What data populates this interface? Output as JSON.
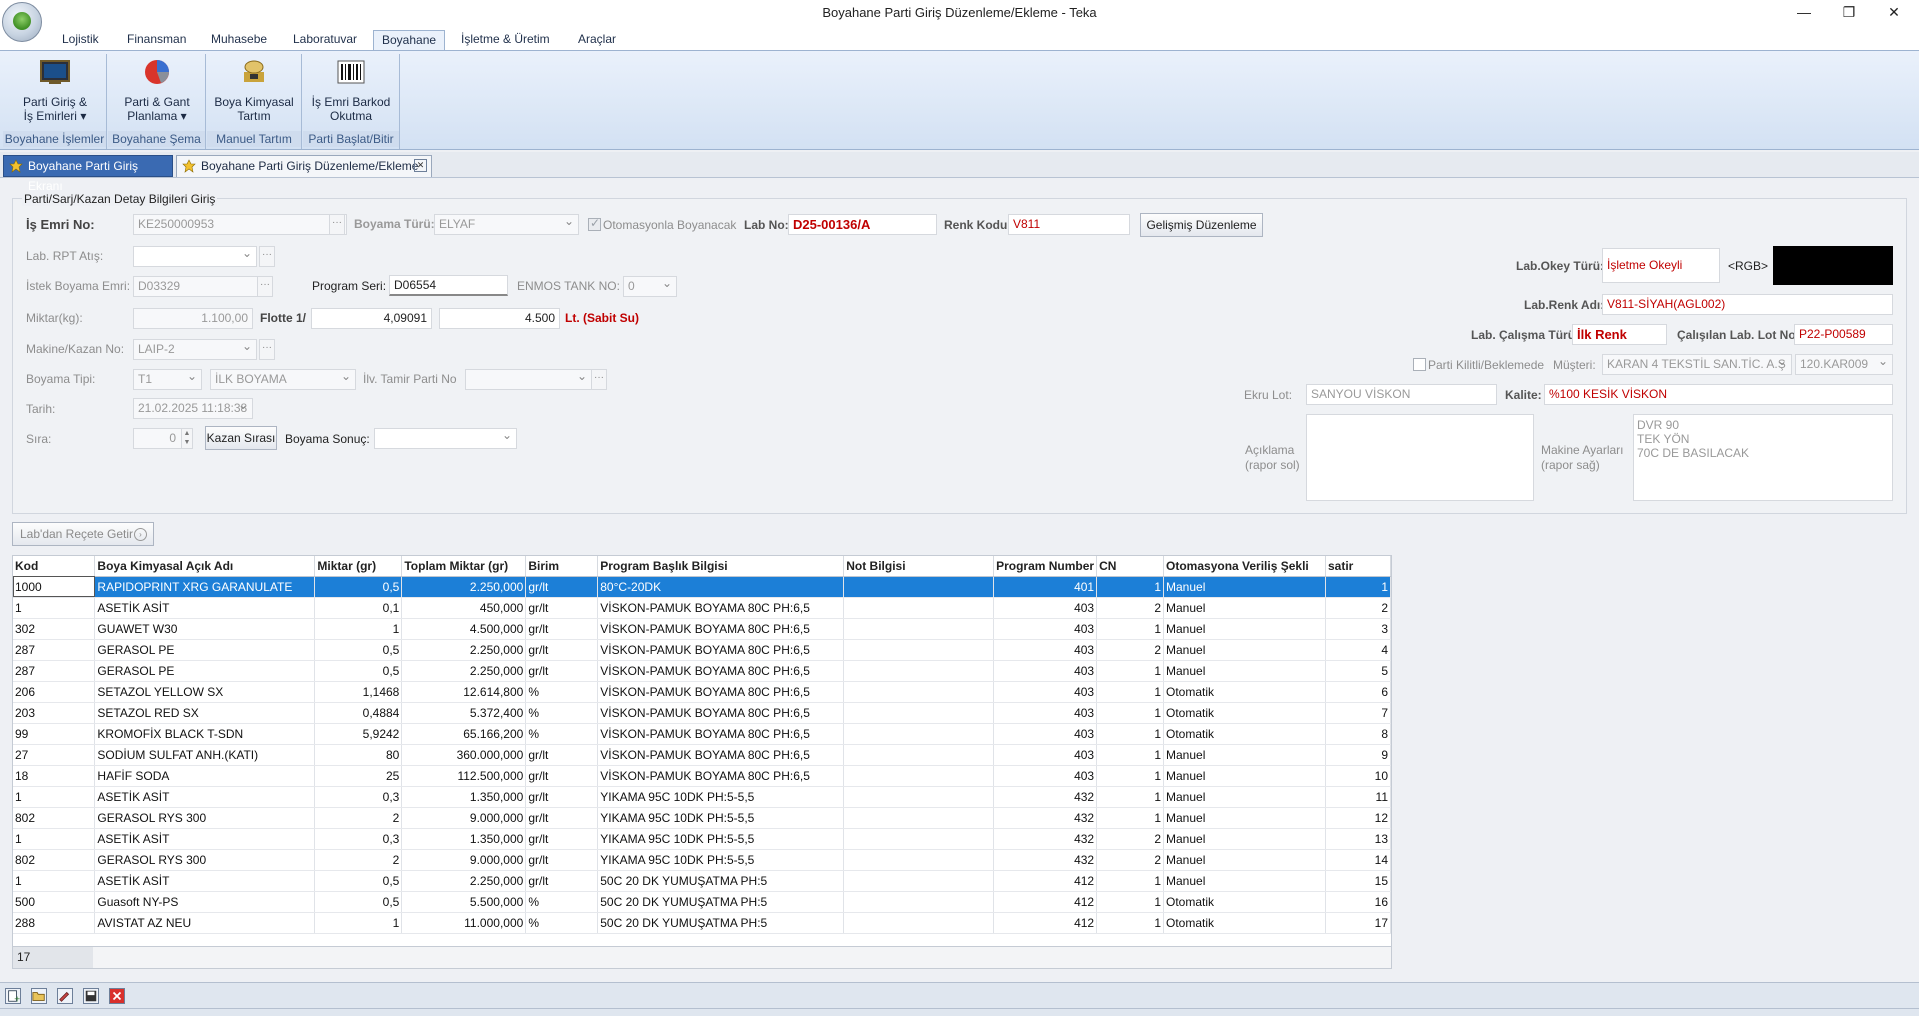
{
  "window": {
    "title": "Boyahane Parti Giriş Düzenleme/Ekleme - Teka",
    "minimize": "—",
    "maximize": "❐",
    "close": "✕"
  },
  "ribbon_tabs": [
    "Lojistik",
    "Finansman",
    "Muhasebe",
    "Laboratuvar",
    "Boyahane",
    "İşletme & Üretim",
    "Araçlar"
  ],
  "ribbon": {
    "btn1_l1": "Parti Giriş &",
    "btn1_l2": "İş Emirleri",
    "grp1": "Boyahane İşlemler",
    "btn2_l1": "Parti & Gant",
    "btn2_l2": "Planlama",
    "grp2": "Boyahane Şema",
    "btn3_l1": "Boya Kimyasal",
    "btn3_l2": "Tartım",
    "grp3": "Manuel Tartım",
    "btn4_l1": "İş Emri Barkod",
    "btn4_l2": "Okutma",
    "grp4": "Parti Başlat/Bitir"
  },
  "doc_tabs": {
    "tab1": "Boyahane Parti Giriş Ekranı",
    "tab2": "Boyahane Parti Giriş Düzenleme/Ekleme",
    "close": "✕"
  },
  "form": {
    "group_title": "Parti/Sarj/Kazan Detay Bilgileri Giriş",
    "is_emri_label": "İş Emri No:",
    "is_emri": "KE250000953",
    "boyama_turu_label": "Boyama Türü:",
    "boyama_turu": "ELYAF",
    "otomasyon_label": "Otomasyonla Boyanacak",
    "lab_no_label": "Lab No:",
    "lab_no": "D25-00136/A",
    "renk_kodu_label": "Renk Kodu:",
    "renk_kodu": "V811",
    "gelismis_btn": "Gelişmiş Düzenleme",
    "lab_rpt_label": "Lab. RPT Atış:",
    "istek_label": "İstek Boyama Emri:",
    "istek": "D03329",
    "program_seri_label": "Program Seri:",
    "program_seri": "D06554",
    "enmos_label": "ENMOS TANK NO:",
    "enmos": "0",
    "miktar_label": "Miktar(kg):",
    "miktar": "1.100,00",
    "flotte_label": "Flotte 1/",
    "flotte": "4,09091",
    "flotte_lt": "4.500",
    "sabit_su": "Lt. (Sabit Su)",
    "makine_label": "Makine/Kazan No:",
    "makine": "LAIP-2",
    "boyama_tipi_label": "Boyama Tipi:",
    "boyama_tipi": "T1",
    "boyama_tipi_desc": "İLK BOYAMA",
    "ilv_label": "İlv. Tamir Parti No",
    "tarih_label": "Tarih:",
    "tarih": "21.02.2025 11:18:38",
    "sira_label": "Sıra:",
    "sira": "0",
    "kazan_btn": "Kazan Sırası",
    "boyama_sonuc_label": "Boyama Sonuç:",
    "lab_okey_label": "Lab.Okey Türü:",
    "lab_okey": "İşletme Okeyli",
    "rgb_label": "<RGB>",
    "rgb_color": "#000000",
    "lab_renk_label": "Lab.Renk Adı:",
    "lab_renk": "V811-SİYAH(AGL002)",
    "lab_calisma_label": "Lab. Çalışma Türü:",
    "lab_calisma": "İlk Renk",
    "calisilan_label": "Çalışılan Lab. Lot No:",
    "calisilan": "P22-P00589",
    "parti_kilit_label": "Parti Kilitli/Beklemede",
    "musteri_label": "Müşteri:",
    "musteri": "KARAN 4 TEKSTİL SAN.TİC. A.Ş",
    "musteri_kod": "120.KAR009",
    "ekru_label": "Ekru Lot:",
    "ekru": "SANYOU VİSKON",
    "kalite_label": "Kalite:",
    "kalite": "%100 KESİK VİSKON",
    "aciklama_l1": "Açıklama",
    "aciklama_l2": "(rapor sol)",
    "makine_ayar_l1": "Makine Ayarları",
    "makine_ayar_l2": "(rapor sağ)",
    "makine_ayar": "DVR 90\nTEK YÖN\n70C DE BASILACAK",
    "lab_recete_btn": "Lab'dan Reçete Getir"
  },
  "grid": {
    "headers": [
      "Kod",
      "Boya Kimyasal Açık Adı",
      "Miktar (gr)",
      "Toplam Miktar (gr)",
      "Birim",
      "Program Başlık Bilgisi",
      "Not Bilgisi",
      "Program Number",
      "CN",
      "Otomasyona Veriliş Şekli",
      "satir"
    ],
    "rows": [
      [
        "1000",
        "RAPIDOPRINT XRG GARANULATE",
        "0,5",
        "2.250,000",
        "gr/lt",
        "80°C-20DK",
        "",
        "401",
        "1",
        "Manuel",
        "1"
      ],
      [
        "1",
        "ASETİK ASİT",
        "0,1",
        "450,000",
        "gr/lt",
        "VİSKON-PAMUK BOYAMA 80C PH:6,5",
        "",
        "403",
        "2",
        "Manuel",
        "2"
      ],
      [
        "302",
        "GUAWET W30",
        "1",
        "4.500,000",
        "gr/lt",
        "VİSKON-PAMUK BOYAMA 80C PH:6,5",
        "",
        "403",
        "1",
        "Manuel",
        "3"
      ],
      [
        "287",
        "GERASOL PE",
        "0,5",
        "2.250,000",
        "gr/lt",
        "VİSKON-PAMUK BOYAMA 80C PH:6,5",
        "",
        "403",
        "2",
        "Manuel",
        "4"
      ],
      [
        "287",
        "GERASOL PE",
        "0,5",
        "2.250,000",
        "gr/lt",
        "VİSKON-PAMUK BOYAMA 80C PH:6,5",
        "",
        "403",
        "1",
        "Manuel",
        "5"
      ],
      [
        "206",
        "SETAZOL YELLOW SX",
        "1,1468",
        "12.614,800",
        "%",
        "VİSKON-PAMUK BOYAMA 80C PH:6,5",
        "",
        "403",
        "1",
        "Otomatik",
        "6"
      ],
      [
        "203",
        "SETAZOL RED SX",
        "0,4884",
        "5.372,400",
        "%",
        "VİSKON-PAMUK BOYAMA 80C PH:6,5",
        "",
        "403",
        "1",
        "Otomatik",
        "7"
      ],
      [
        "99",
        "KROMOFİX BLACK T-SDN",
        "5,9242",
        "65.166,200",
        "%",
        "VİSKON-PAMUK BOYAMA 80C PH:6,5",
        "",
        "403",
        "1",
        "Otomatik",
        "8"
      ],
      [
        "27",
        "SODİUM SULFAT ANH.(KATI)",
        "80",
        "360.000,000",
        "gr/lt",
        "VİSKON-PAMUK BOYAMA 80C PH:6,5",
        "",
        "403",
        "1",
        "Manuel",
        "9"
      ],
      [
        "18",
        "HAFİF SODA",
        "25",
        "112.500,000",
        "gr/lt",
        "VİSKON-PAMUK BOYAMA 80C PH:6,5",
        "",
        "403",
        "1",
        "Manuel",
        "10"
      ],
      [
        "1",
        "ASETİK ASİT",
        "0,3",
        "1.350,000",
        "gr/lt",
        "YIKAMA 95C 10DK PH:5-5,5",
        "",
        "432",
        "1",
        "Manuel",
        "11"
      ],
      [
        "802",
        "GERASOL RYS 300",
        "2",
        "9.000,000",
        "gr/lt",
        "YIKAMA 95C 10DK PH:5-5,5",
        "",
        "432",
        "1",
        "Manuel",
        "12"
      ],
      [
        "1",
        "ASETİK ASİT",
        "0,3",
        "1.350,000",
        "gr/lt",
        "YIKAMA 95C 10DK PH:5-5,5",
        "",
        "432",
        "2",
        "Manuel",
        "13"
      ],
      [
        "802",
        "GERASOL RYS 300",
        "2",
        "9.000,000",
        "gr/lt",
        "YIKAMA 95C 10DK PH:5-5,5",
        "",
        "432",
        "2",
        "Manuel",
        "14"
      ],
      [
        "1",
        "ASETİK ASİT",
        "0,5",
        "2.250,000",
        "gr/lt",
        "50C 20 DK YUMUŞATMA PH:5",
        "",
        "412",
        "1",
        "Manuel",
        "15"
      ],
      [
        "500",
        "Guasoft NY-PS",
        "0,5",
        "5.500,000",
        "%",
        "50C 20 DK YUMUŞATMA PH:5",
        "",
        "412",
        "1",
        "Otomatik",
        "16"
      ],
      [
        "288",
        "AVISTAT AZ NEU",
        "1",
        "11.000,000",
        "%",
        "50C 20 DK YUMUŞATMA PH:5",
        "",
        "412",
        "1",
        "Otomatik",
        "17"
      ]
    ],
    "row_count": "17"
  }
}
